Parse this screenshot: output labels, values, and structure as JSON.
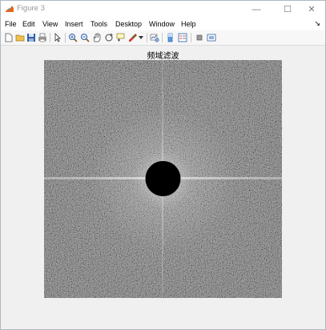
{
  "window": {
    "title": "Figure 3",
    "controls": {
      "minimize": "—",
      "maximize": "☐",
      "close": "✕"
    }
  },
  "menubar": {
    "items": [
      "File",
      "Edit",
      "View",
      "Insert",
      "Tools",
      "Desktop",
      "Window",
      "Help"
    ],
    "overflow_arrow": "↘"
  },
  "toolbar": {
    "buttons": [
      "new-figure-icon",
      "open-file-icon",
      "save-icon",
      "print-icon",
      "edit-plot-arrow-icon",
      "zoom-in-icon",
      "zoom-out-icon",
      "pan-icon",
      "rotate-3d-icon",
      "data-cursor-icon",
      "brush-icon",
      "link-plot-icon",
      "insert-colorbar-icon",
      "insert-legend-icon",
      "hide-plot-tools-icon",
      "show-plot-tools-icon"
    ]
  },
  "figure": {
    "title": "频域滤波",
    "colors": {
      "background": "#6b6b6b",
      "mask": "#000000",
      "axis_glow": "#d8d8d8"
    }
  }
}
